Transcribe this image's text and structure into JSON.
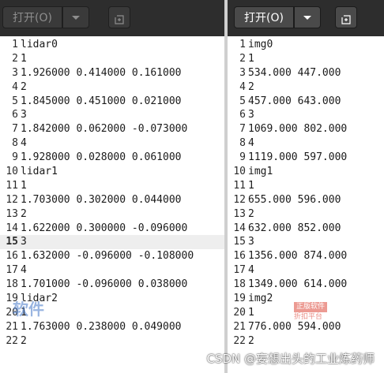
{
  "left_window": {
    "open_label": "打开(O)",
    "lines": [
      "lidar0",
      "1",
      "1.926000 0.414000 0.161000",
      "2",
      "1.845000 0.451000 0.021000",
      "3",
      "1.842000 0.062000 -0.073000",
      "4",
      "1.928000 0.028000 0.061000",
      "lidar1",
      "1",
      "1.703000 0.302000 0.044000",
      "2",
      "1.622000 0.300000 -0.096000",
      "3",
      "1.632000 -0.096000 -0.108000",
      "4",
      "1.701000 -0.096000 0.038000",
      "lidar2",
      "1",
      "1.763000 0.238000 0.049000",
      "2"
    ],
    "line_numbers": [
      "1",
      "2",
      "3",
      "4",
      "5",
      "6",
      "7",
      "8",
      "9",
      "10",
      "11",
      "12",
      "13",
      "14",
      "15",
      "16",
      "17",
      "18",
      "19",
      "20",
      "21",
      "22"
    ],
    "current_line": 15
  },
  "right_window": {
    "open_label": "打开(O)",
    "lines": [
      "img0",
      "1",
      "534.000 447.000",
      "2",
      "457.000 643.000",
      "3",
      "1069.000 802.000",
      "4",
      "1119.000 597.000",
      "img1",
      "1",
      "655.000 596.000",
      "2",
      "632.000 852.000",
      "3",
      "1356.000 874.000",
      "4",
      "1349.000 614.000",
      "img2",
      "1",
      "776.000 594.000",
      "2"
    ],
    "line_numbers": [
      "1",
      "2",
      "3",
      "4",
      "5",
      "6",
      "7",
      "8",
      "9",
      "10",
      "11",
      "12",
      "13",
      "14",
      "15",
      "16",
      "17",
      "18",
      "19",
      "20",
      "21",
      "22"
    ]
  },
  "watermark": {
    "logo_text": "软件",
    "badge_top": "正版软件",
    "badge_bottom": "折扣平台",
    "csdn": "CSDN @妄想出头的工业炼药师"
  },
  "icons": {
    "dropdown": "chevron-down-icon",
    "new_document": "new-document-icon"
  },
  "colors": {
    "toolbar_bg": "#2d2d2d",
    "editor_bg": "#ffffff",
    "current_line_bg": "#eeeeee"
  }
}
